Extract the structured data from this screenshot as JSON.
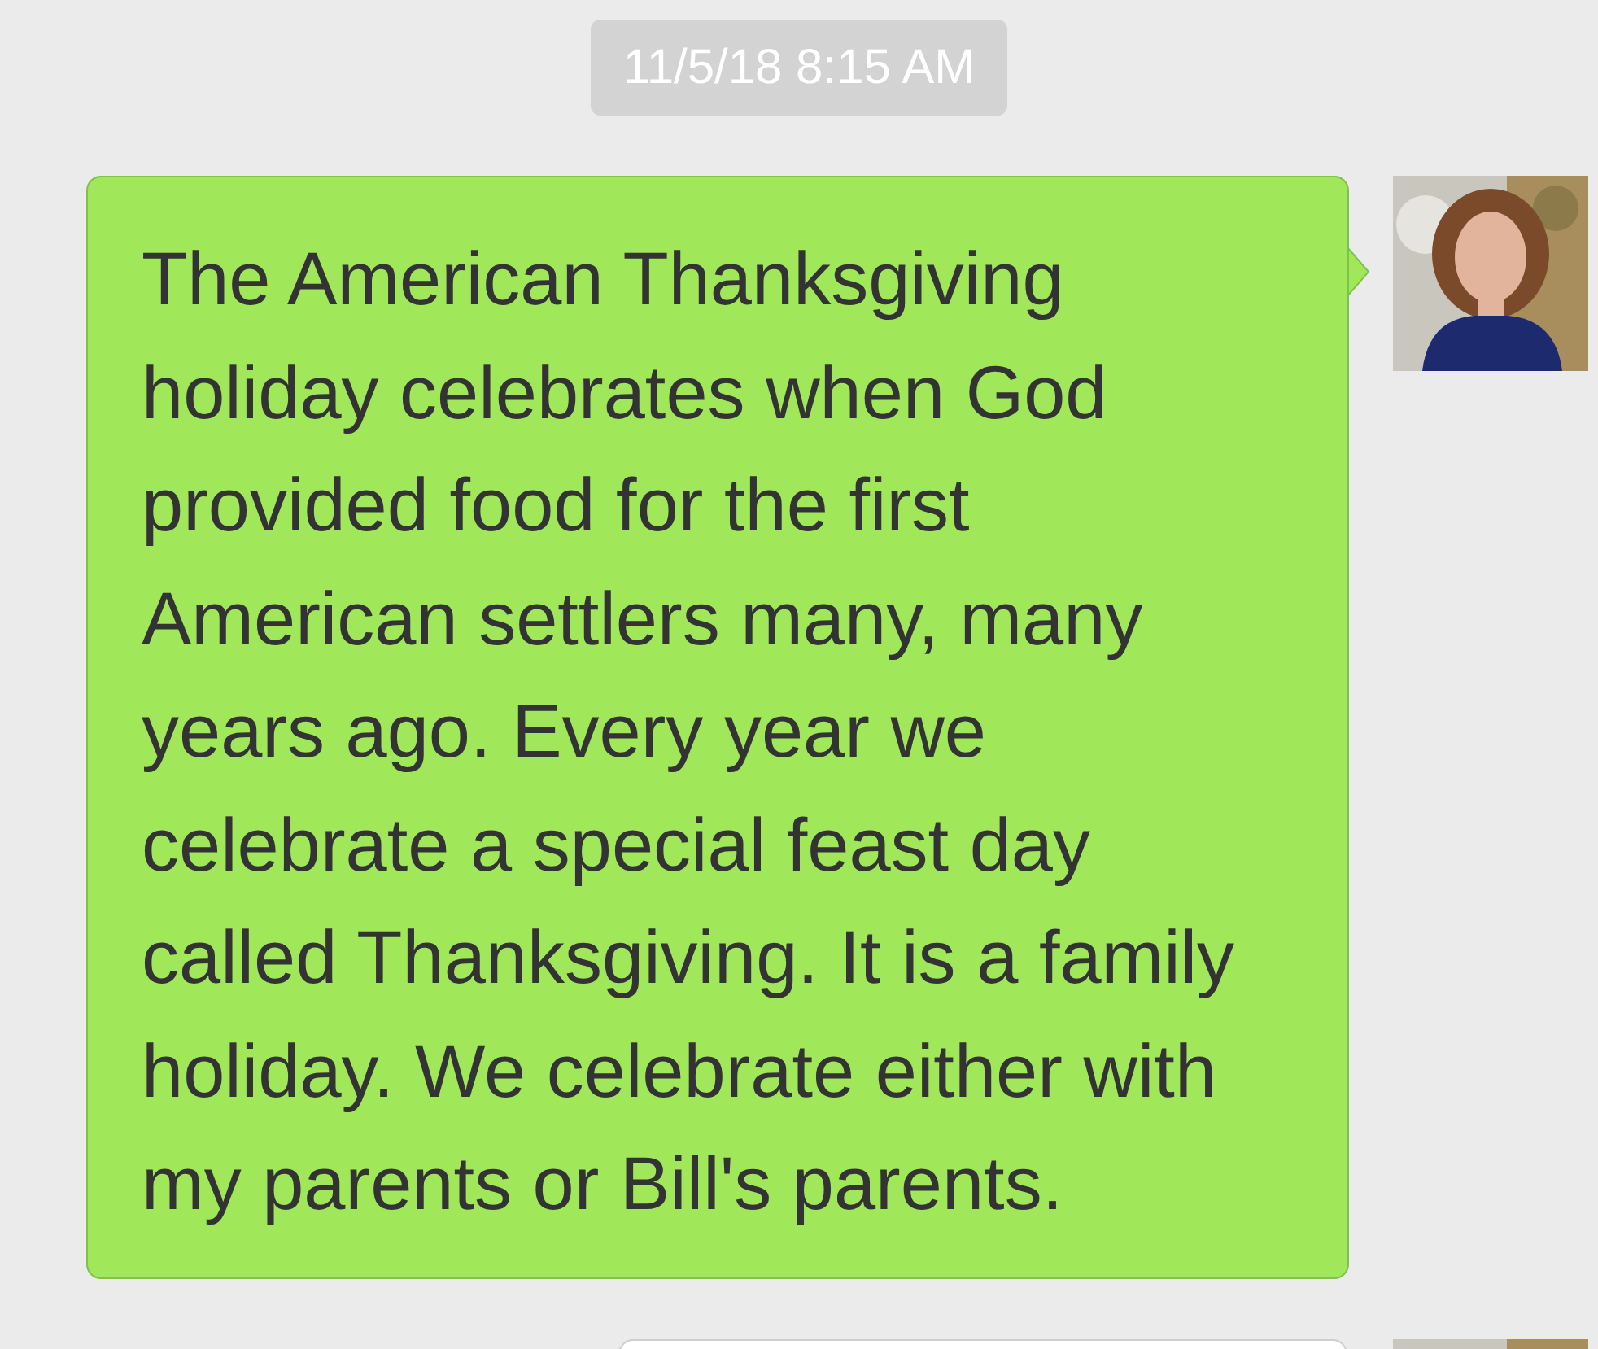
{
  "timestamp": "11/5/18 8:15 AM",
  "messages": [
    {
      "kind": "text",
      "text": "The American Thanksgiving holiday celebrates when God provided food for the first American settlers many, many years ago. Every year we celebrate a special feast day called Thanksgiving. It is a family holiday. We celebrate either with my parents or Bill's parents."
    },
    {
      "kind": "cut"
    }
  ]
}
